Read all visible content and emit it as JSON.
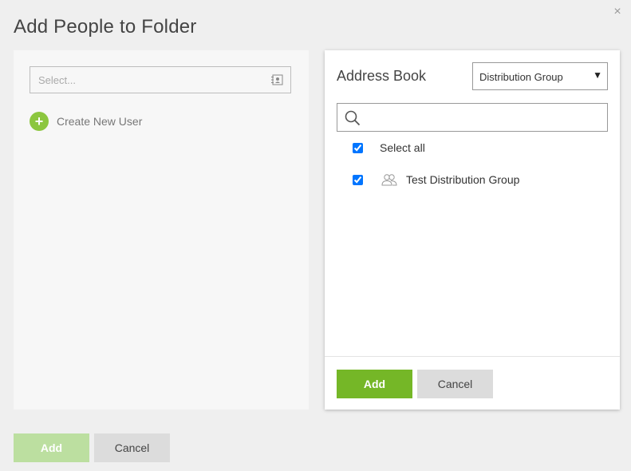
{
  "dialog": {
    "title": "Add People to Folder",
    "close_label": "×"
  },
  "left_panel": {
    "select_placeholder": "Select...",
    "create_user_icon": "+",
    "create_user_label": "Create New User"
  },
  "address_book": {
    "title": "Address Book",
    "dropdown": {
      "selected": "Distribution Group",
      "arrow": "▼"
    },
    "search": {
      "value": "",
      "placeholder": ""
    },
    "select_all": {
      "label": "Select all",
      "checked": true
    },
    "items": [
      {
        "label": "Test Distribution Group",
        "icon": "group-icon",
        "checked": true
      }
    ],
    "add_label": "Add",
    "cancel_label": "Cancel"
  },
  "footer": {
    "add_label": "Add",
    "cancel_label": "Cancel"
  },
  "colors": {
    "accent_green": "#75b727",
    "accent_green_disabled": "#bcdfa0",
    "plus_green": "#8cc63f"
  }
}
